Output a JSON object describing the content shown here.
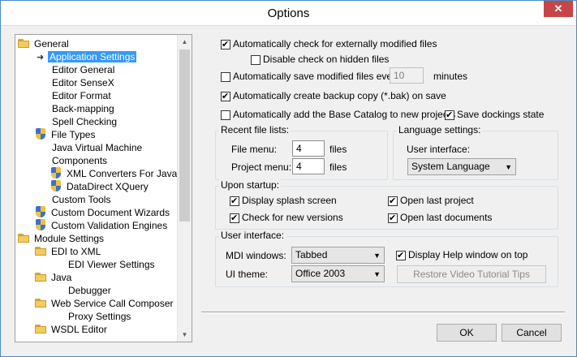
{
  "window": {
    "title": "Options",
    "close_glyph": "✕"
  },
  "tree": {
    "items": [
      {
        "label": "General",
        "icon": "folder-icon",
        "selected": false
      },
      {
        "label": "Application Settings",
        "icon": "arrow-icon",
        "selected": true
      },
      {
        "label": "Editor General",
        "icon": "",
        "selected": false
      },
      {
        "label": "Editor SenseX",
        "icon": "",
        "selected": false
      },
      {
        "label": "Editor Format",
        "icon": "",
        "selected": false
      },
      {
        "label": "Back-mapping",
        "icon": "",
        "selected": false
      },
      {
        "label": "Spell Checking",
        "icon": "",
        "selected": false
      },
      {
        "label": "File Types",
        "icon": "shield-icon",
        "selected": false
      },
      {
        "label": "Java Virtual Machine",
        "icon": "",
        "selected": false
      },
      {
        "label": "Components",
        "icon": "",
        "selected": false
      },
      {
        "label": "XML Converters For Java",
        "icon": "shield-icon",
        "selected": false
      },
      {
        "label": "DataDirect XQuery",
        "icon": "shield-icon",
        "selected": false
      },
      {
        "label": "Custom Tools",
        "icon": "",
        "selected": false
      },
      {
        "label": "Custom Document Wizards",
        "icon": "shield-icon",
        "selected": false
      },
      {
        "label": "Custom Validation Engines",
        "icon": "shield-icon",
        "selected": false
      },
      {
        "label": "Module Settings",
        "icon": "folder-icon",
        "selected": false
      },
      {
        "label": "EDI to XML",
        "icon": "folder-icon",
        "selected": false
      },
      {
        "label": "EDI Viewer Settings",
        "icon": "",
        "selected": false
      },
      {
        "label": "Java",
        "icon": "folder-icon",
        "selected": false
      },
      {
        "label": "Debugger",
        "icon": "",
        "selected": false
      },
      {
        "label": "Web Service Call Composer",
        "icon": "folder-icon",
        "selected": false
      },
      {
        "label": "Proxy Settings",
        "icon": "",
        "selected": false
      },
      {
        "label": "WSDL Editor",
        "icon": "folder-icon",
        "selected": false
      }
    ]
  },
  "options": {
    "check_external": {
      "label": "Automatically check for externally modified files",
      "checked": true
    },
    "disable_hidden": {
      "label": "Disable check on hidden files",
      "checked": false
    },
    "autosave": {
      "label": "Automatically save modified files every",
      "checked": false,
      "value": "10",
      "unit": "minutes"
    },
    "backup": {
      "label": "Automatically create backup copy (*.bak) on save",
      "checked": true
    },
    "base_catalog": {
      "label": "Automatically add the Base Catalog to new projects",
      "checked": false
    },
    "save_docking": {
      "label": "Save dockings state",
      "checked": true
    }
  },
  "recent": {
    "legend": "Recent file lists:",
    "file_menu_label": "File menu:",
    "file_menu_value": "4",
    "files_unit": "files",
    "project_menu_label": "Project menu:",
    "project_menu_value": "4"
  },
  "language": {
    "legend": "Language settings:",
    "ui_label": "User interface:",
    "ui_value": "System Language"
  },
  "startup": {
    "legend": "Upon startup:",
    "splash": {
      "label": "Display splash screen",
      "checked": true
    },
    "new_versions": {
      "label": "Check for new versions",
      "checked": true
    },
    "last_project": {
      "label": "Open last project",
      "checked": true
    },
    "last_docs": {
      "label": "Open last documents",
      "checked": true
    }
  },
  "ui": {
    "legend": "User interface:",
    "mdi_label": "MDI windows:",
    "mdi_value": "Tabbed",
    "theme_label": "UI theme:",
    "theme_value": "Office 2003",
    "help_window": {
      "label": "Display Help window on top",
      "checked": true
    },
    "restore_label": "Restore Video Tutorial Tips"
  },
  "footer": {
    "ok_label": "OK",
    "cancel_label": "Cancel"
  },
  "colors": {
    "selection": "#3399ff",
    "close": "#c74545"
  }
}
